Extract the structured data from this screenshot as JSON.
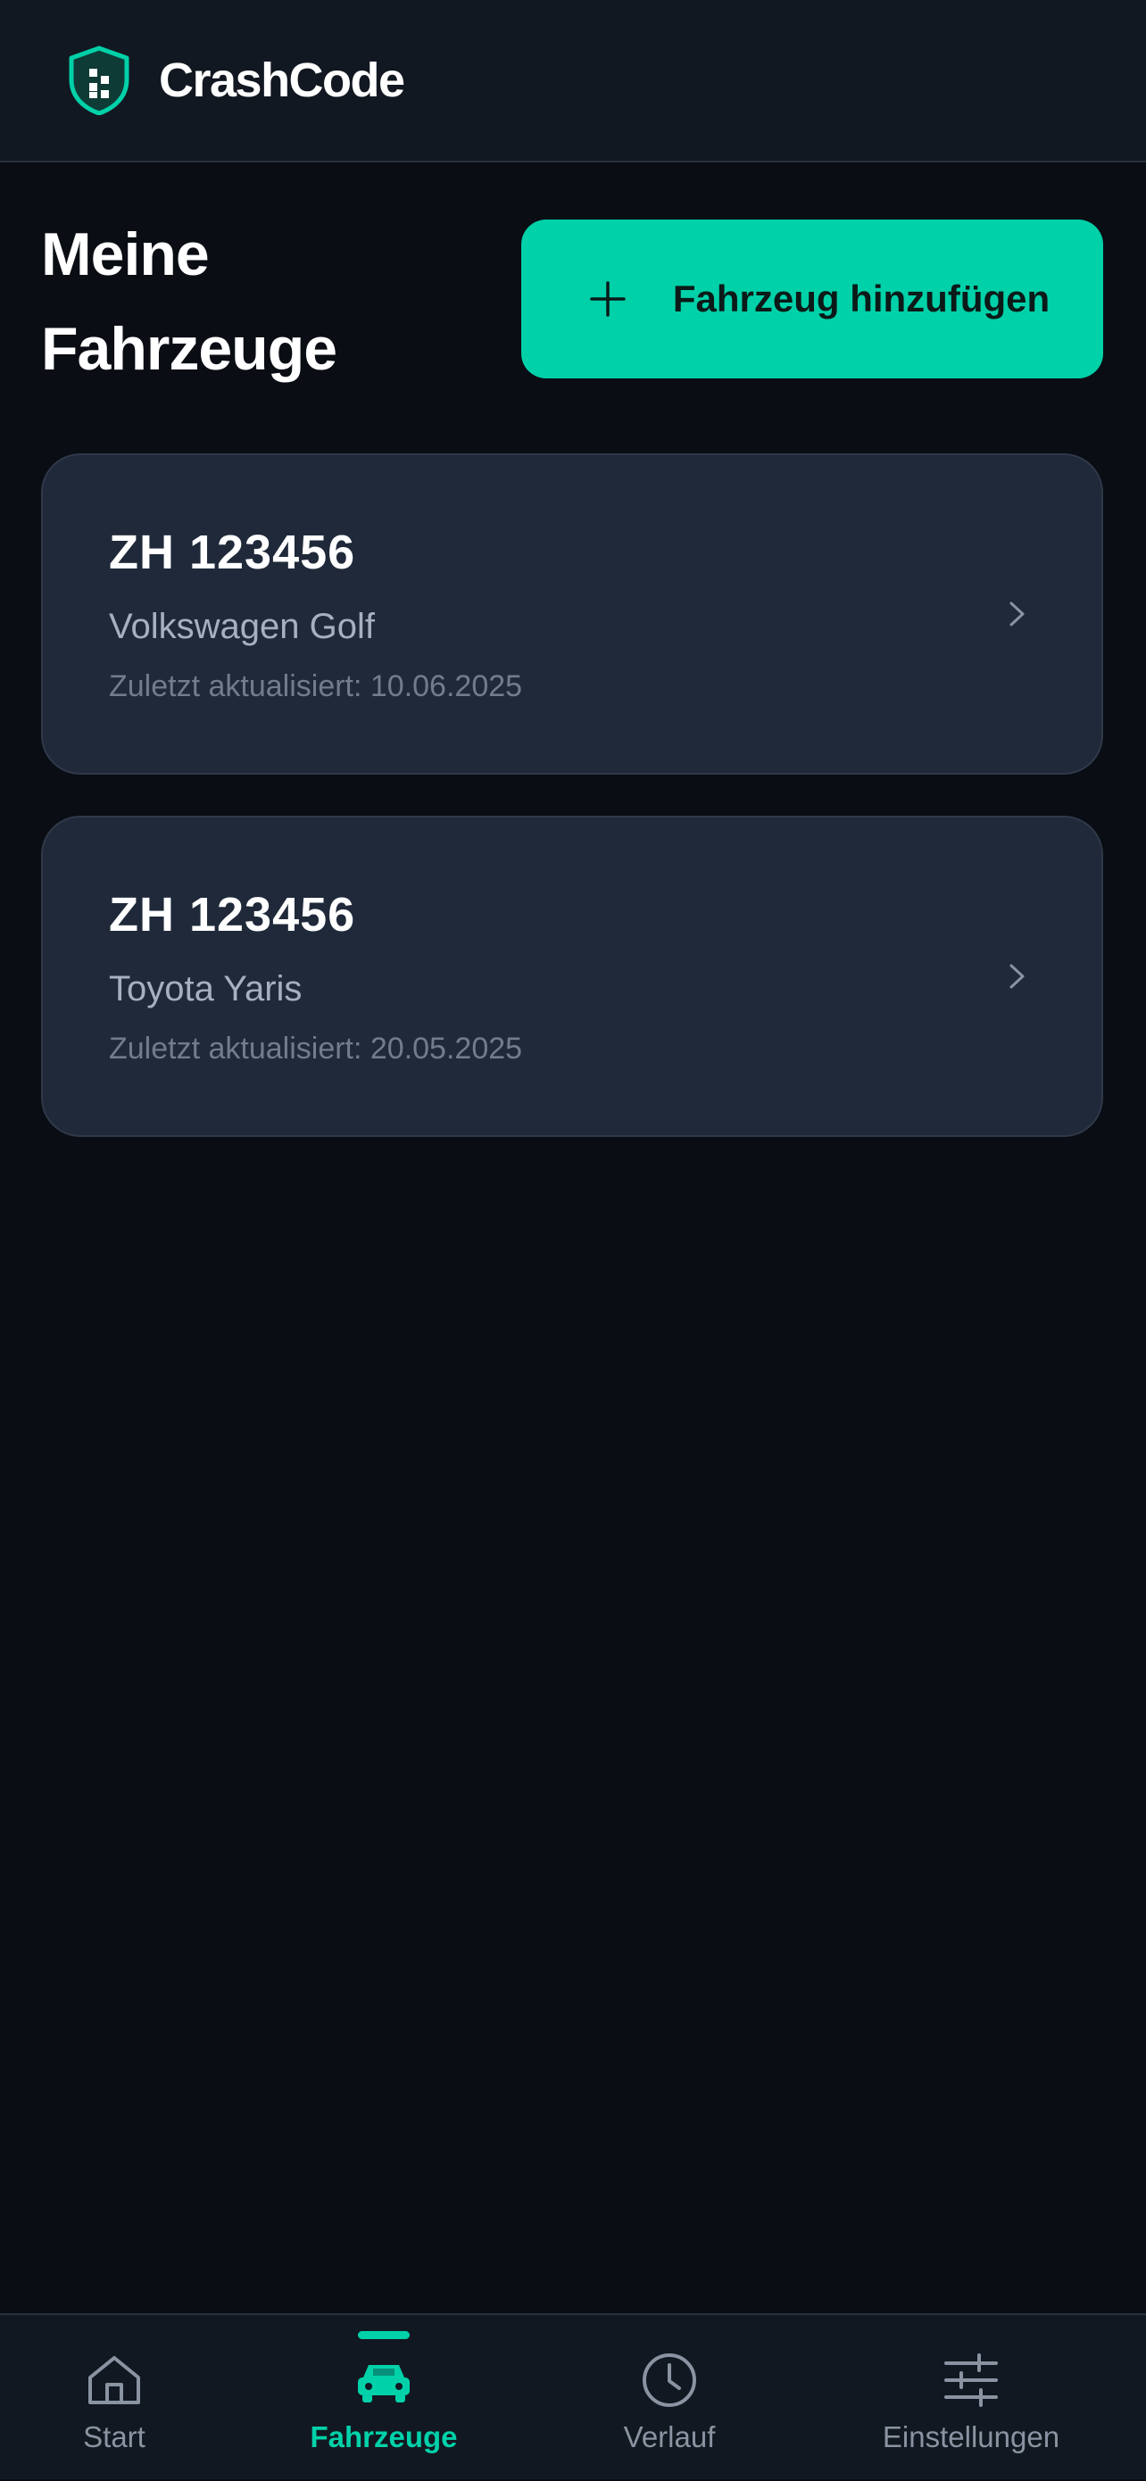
{
  "header": {
    "app_title": "CrashCode",
    "logo_icon": "shield-icon"
  },
  "main": {
    "page_title": "Meine Fahrzeuge",
    "add_button": {
      "label": "Fahrzeug hinzufügen",
      "icon": "plus-icon"
    },
    "vehicles": [
      {
        "plate": "ZH 123456",
        "model": "Volkswagen Golf",
        "updated": "Zuletzt aktualisiert: 10.06.2025"
      },
      {
        "plate": "ZH 123456",
        "model": "Toyota Yaris",
        "updated": "Zuletzt aktualisiert: 20.05.2025"
      }
    ]
  },
  "bottom_nav": {
    "items": [
      {
        "label": "Start",
        "icon": "home-icon",
        "active": false
      },
      {
        "label": "Fahrzeuge",
        "icon": "car-icon",
        "active": true
      },
      {
        "label": "Verlauf",
        "icon": "clock-icon",
        "active": false
      },
      {
        "label": "Einstellungen",
        "icon": "sliders-icon",
        "active": false
      }
    ]
  },
  "colors": {
    "accent": "#00d1a9",
    "background": "#0a0d14",
    "header_background": "#121821",
    "card_background": "#1f293a",
    "muted_text": "#8a93a1"
  }
}
